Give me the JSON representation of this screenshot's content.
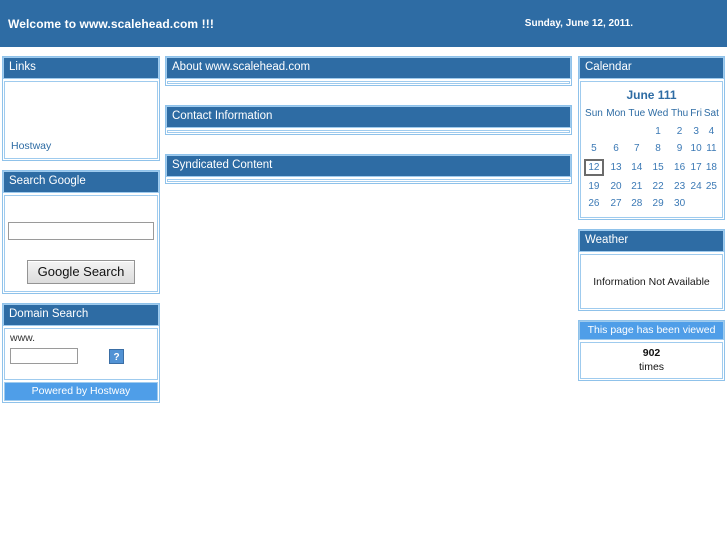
{
  "banner": {
    "title": "Welcome to www.scalehead.com !!!",
    "date": "Sunday, June 12, 2011."
  },
  "left_column": {
    "links_panel": {
      "heading": "Links",
      "items": [
        {
          "label": "Hostway"
        }
      ]
    },
    "search_google_panel": {
      "heading": "Search Google",
      "query_value": "",
      "query_placeholder": "",
      "button_label": "Google Search"
    },
    "domain_search_panel": {
      "heading": "Domain Search",
      "prefix_label": "www.",
      "domain_value": "",
      "domain_placeholder": "",
      "broken_image_glyph": "?",
      "footer_label": "Powered by Hostway"
    }
  },
  "center_column": {
    "panels": [
      {
        "heading": "About www.scalehead.com"
      },
      {
        "heading": "Contact Information"
      },
      {
        "heading": "Syndicated Content"
      }
    ]
  },
  "right_column": {
    "calendar_panel": {
      "heading": "Calendar",
      "month_title": "June 111",
      "weekdays": [
        "Sun",
        "Mon",
        "Tue",
        "Wed",
        "Thu",
        "Fri",
        "Sat"
      ],
      "today": 12,
      "weeks": [
        [
          "",
          "",
          "",
          "1",
          "2",
          "3",
          "4"
        ],
        [
          "5",
          "6",
          "7",
          "8",
          "9",
          "10",
          "11"
        ],
        [
          "12",
          "13",
          "14",
          "15",
          "16",
          "17",
          "18"
        ],
        [
          "19",
          "20",
          "21",
          "22",
          "23",
          "24",
          "25"
        ],
        [
          "26",
          "27",
          "28",
          "29",
          "30",
          "",
          ""
        ]
      ]
    },
    "weather_panel": {
      "heading": "Weather",
      "message": "Information Not Available"
    },
    "counter_panel": {
      "heading": "This page has been viewed",
      "count": "902",
      "unit": "times"
    }
  },
  "colors": {
    "header_blue": "#2e6ca4",
    "accent_light_blue": "#4f9ee8",
    "panel_border": "#8fc2ea",
    "link_blue": "#2e6ca4"
  }
}
